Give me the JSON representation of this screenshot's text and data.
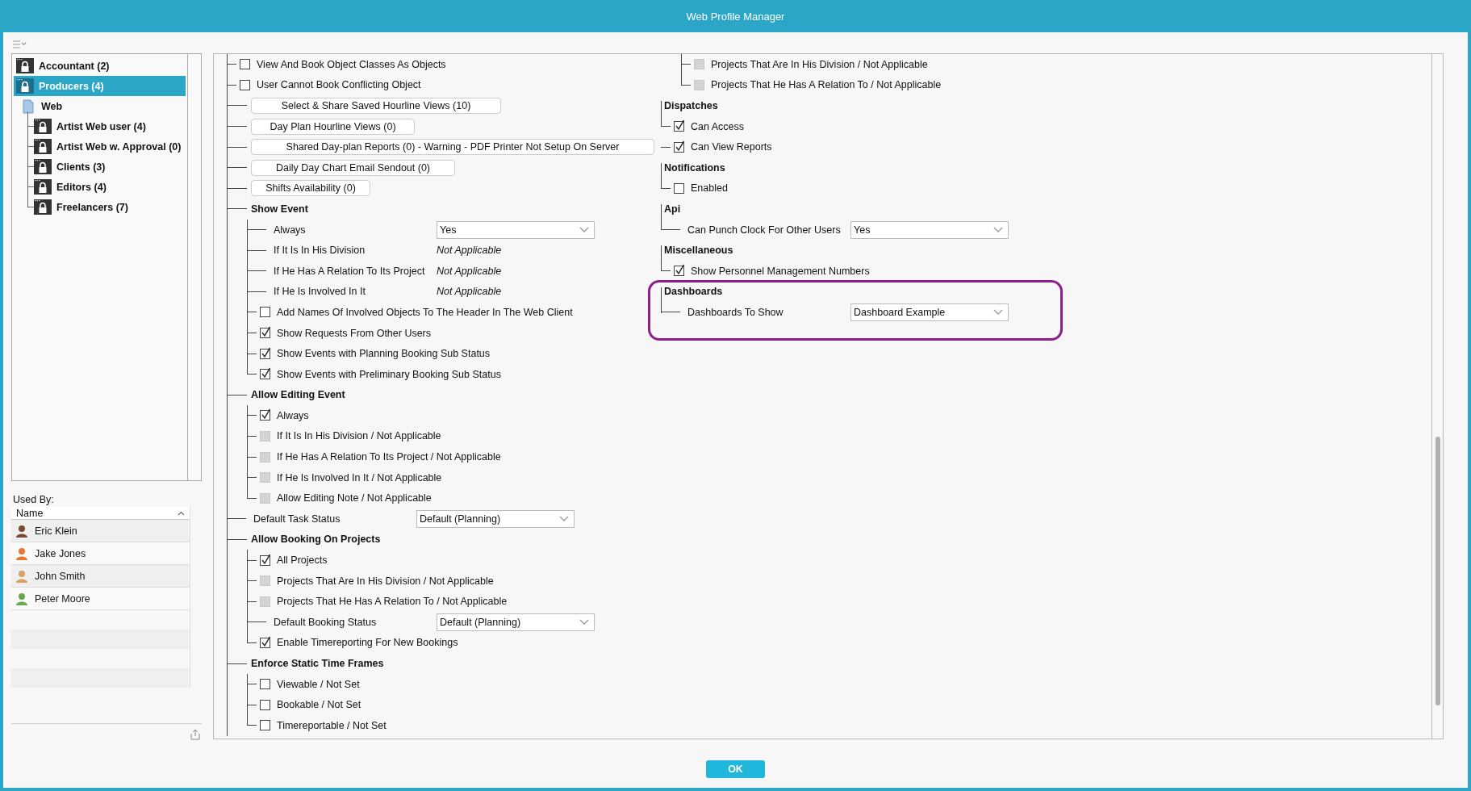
{
  "window": {
    "title": "Web Profile Manager"
  },
  "profile_tree": {
    "items": [
      {
        "label": "Accountant (2)",
        "kind": "profile",
        "selected": false
      },
      {
        "label": "Producers (4)",
        "kind": "profile",
        "selected": true
      },
      {
        "label": "Web",
        "kind": "folder",
        "selected": false,
        "children": [
          {
            "label": "Artist Web user (4)",
            "kind": "profile",
            "selected": false
          },
          {
            "label": "Artist Web w. Approval (0)",
            "kind": "profile",
            "selected": false
          },
          {
            "label": "Clients (3)",
            "kind": "profile",
            "selected": false
          },
          {
            "label": "Editors (4)",
            "kind": "profile",
            "selected": false
          },
          {
            "label": "Freelancers (7)",
            "kind": "profile",
            "selected": false
          }
        ]
      }
    ]
  },
  "used_by": {
    "label": "Used By:",
    "column": "Name",
    "rows": [
      {
        "name": "Eric Klein",
        "color": "#7a4a35"
      },
      {
        "name": "Jake Jones",
        "color": "#e8772e"
      },
      {
        "name": "John Smith",
        "color": "#d9a066"
      },
      {
        "name": "Peter Moore",
        "color": "#6aa84f"
      }
    ]
  },
  "settings": {
    "left_column": [
      {
        "kind": "checkbox",
        "label": "View And Book Object Classes As Objects",
        "checked": false,
        "disabled": false
      },
      {
        "kind": "checkbox",
        "label": "User Cannot Book Conflicting Object",
        "checked": false,
        "disabled": false
      },
      {
        "kind": "button",
        "label": "Select & Share Saved Hourline Views (10)"
      },
      {
        "kind": "button",
        "label": "Day Plan Hourline Views (0)"
      },
      {
        "kind": "button",
        "label": "Shared Day-plan Reports (0) - Warning - PDF Printer Not Setup On Server"
      },
      {
        "kind": "button",
        "label": "Daily Day Chart Email Sendout (0)"
      },
      {
        "kind": "button",
        "label": "Shifts Availability (0)"
      },
      {
        "kind": "group",
        "label": "Show Event",
        "highlighted": false,
        "children": [
          {
            "kind": "select",
            "label": "Always",
            "value": "Yes"
          },
          {
            "kind": "value",
            "label": "If It Is In His Division",
            "value": "Not Applicable"
          },
          {
            "kind": "value",
            "label": "If He Has A Relation To Its Project",
            "value": "Not Applicable"
          },
          {
            "kind": "value",
            "label": "If He Is Involved In It",
            "value": "Not Applicable"
          },
          {
            "kind": "checkbox",
            "label": "Add Names Of Involved Objects To The Header In The Web Client",
            "checked": false,
            "disabled": false
          },
          {
            "kind": "checkbox",
            "label": "Show Requests From Other Users",
            "checked": true,
            "disabled": false
          },
          {
            "kind": "checkbox",
            "label": "Show Events with Planning Booking Sub Status",
            "checked": true,
            "disabled": false
          },
          {
            "kind": "checkbox",
            "label": "Show Events with Preliminary Booking Sub Status",
            "checked": true,
            "disabled": false
          }
        ]
      },
      {
        "kind": "group",
        "label": "Allow Editing Event",
        "highlighted": false,
        "children": [
          {
            "kind": "checkbox",
            "label": "Always",
            "checked": true,
            "disabled": false
          },
          {
            "kind": "checkbox",
            "label": "If It Is In His Division / Not Applicable",
            "checked": false,
            "disabled": true
          },
          {
            "kind": "checkbox",
            "label": "If He Has A Relation To Its Project / Not Applicable",
            "checked": false,
            "disabled": true
          },
          {
            "kind": "checkbox",
            "label": "If He Is Involved In It / Not Applicable",
            "checked": false,
            "disabled": true
          },
          {
            "kind": "checkbox",
            "label": "Allow Editing Note / Not Applicable",
            "checked": false,
            "disabled": true
          }
        ]
      },
      {
        "kind": "select",
        "label": "Default Task Status",
        "value": "Default (Planning)"
      },
      {
        "kind": "group",
        "label": "Allow Booking On Projects",
        "highlighted": false,
        "children": [
          {
            "kind": "checkbox",
            "label": "All Projects",
            "checked": true,
            "disabled": false
          },
          {
            "kind": "checkbox",
            "label": "Projects That Are In His Division / Not Applicable",
            "checked": false,
            "disabled": true
          },
          {
            "kind": "checkbox",
            "label": "Projects That He Has A Relation To / Not Applicable",
            "checked": false,
            "disabled": true
          },
          {
            "kind": "select",
            "label": "Default Booking Status",
            "value": "Default (Planning)"
          },
          {
            "kind": "checkbox",
            "label": "Enable Timereporting For New Bookings",
            "checked": true,
            "disabled": false
          }
        ]
      },
      {
        "kind": "group",
        "label": "Enforce Static Time Frames",
        "highlighted": false,
        "children": [
          {
            "kind": "checkbox",
            "label": "Viewable / Not Set",
            "checked": false,
            "disabled": false
          },
          {
            "kind": "checkbox",
            "label": "Bookable / Not Set",
            "checked": false,
            "disabled": false
          },
          {
            "kind": "checkbox",
            "label": "Timereportable / Not Set",
            "checked": false,
            "disabled": false
          }
        ]
      }
    ],
    "right_column": [
      {
        "kind": "tail",
        "children": [
          {
            "kind": "checkbox",
            "label": "Projects That Are In His Division / Not Applicable",
            "checked": false,
            "disabled": true
          },
          {
            "kind": "checkbox",
            "label": "Projects That He Has A Relation To / Not Applicable",
            "checked": false,
            "disabled": true
          }
        ]
      },
      {
        "kind": "group",
        "label": "Dispatches",
        "highlighted": false,
        "children": [
          {
            "kind": "checkbox",
            "label": "Can Access",
            "checked": true,
            "disabled": false
          },
          {
            "kind": "checkbox",
            "label": "Can View Reports",
            "checked": true,
            "disabled": false
          }
        ]
      },
      {
        "kind": "group",
        "label": "Notifications",
        "highlighted": false,
        "children": [
          {
            "kind": "checkbox",
            "label": "Enabled",
            "checked": false,
            "disabled": false
          }
        ]
      },
      {
        "kind": "group",
        "label": "Api",
        "highlighted": false,
        "children": [
          {
            "kind": "select",
            "label": "Can Punch Clock For Other Users",
            "value": "Yes"
          }
        ]
      },
      {
        "kind": "group",
        "label": "Miscellaneous",
        "highlighted": false,
        "children": [
          {
            "kind": "checkbox",
            "label": "Show Personnel Management Numbers",
            "checked": true,
            "disabled": false
          }
        ]
      },
      {
        "kind": "group",
        "label": "Dashboards",
        "highlighted": true,
        "children": [
          {
            "kind": "select",
            "label": "Dashboards To Show",
            "value": "Dashboard Example"
          }
        ]
      }
    ]
  },
  "footer": {
    "ok_button": "OK"
  }
}
